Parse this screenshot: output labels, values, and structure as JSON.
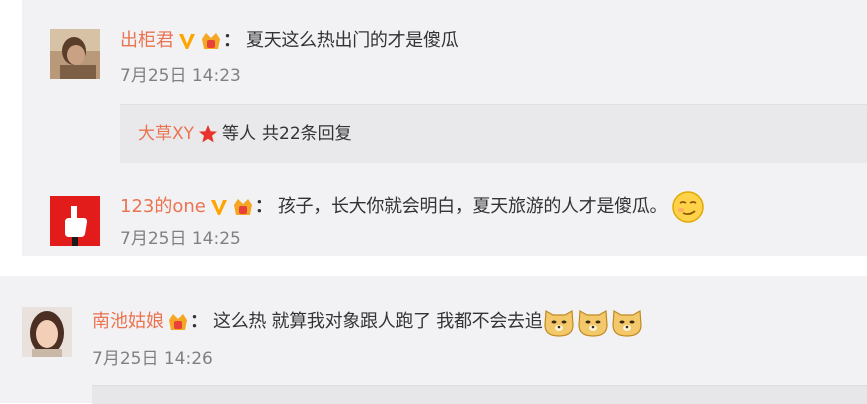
{
  "comments": [
    {
      "user": "出柜君",
      "text": "夏天这么热出门的才是傻瓜",
      "time": "7月25日 14:23",
      "avatar": "person-photo-dark"
    },
    {
      "user": "123的one",
      "text": "孩子，长大你就会明白，夏天旅游的人才是傻瓜。",
      "time": "7月25日 14:25",
      "avatar": "thumbs-up-hand-red"
    },
    {
      "user": "南池姑娘",
      "text": "这么热 就算我对象跟人跑了 我都不会去追",
      "time": "7月25日 14:26",
      "avatar": "girl-photo"
    }
  ],
  "reply_summary": {
    "user": "大草XY",
    "suffix": "等人",
    "count_text": "共22条回复"
  },
  "separator": "：",
  "colors": {
    "username": "#eb7350",
    "text": "#333333",
    "time": "#808080",
    "panel": "#f2f2f5",
    "verified_v": "#ffa500"
  },
  "icons": [
    "verified-v-icon",
    "vip-crown-badge-icon",
    "red-star-icon",
    "smirk-emoji-icon",
    "doge-emoji-icon"
  ]
}
